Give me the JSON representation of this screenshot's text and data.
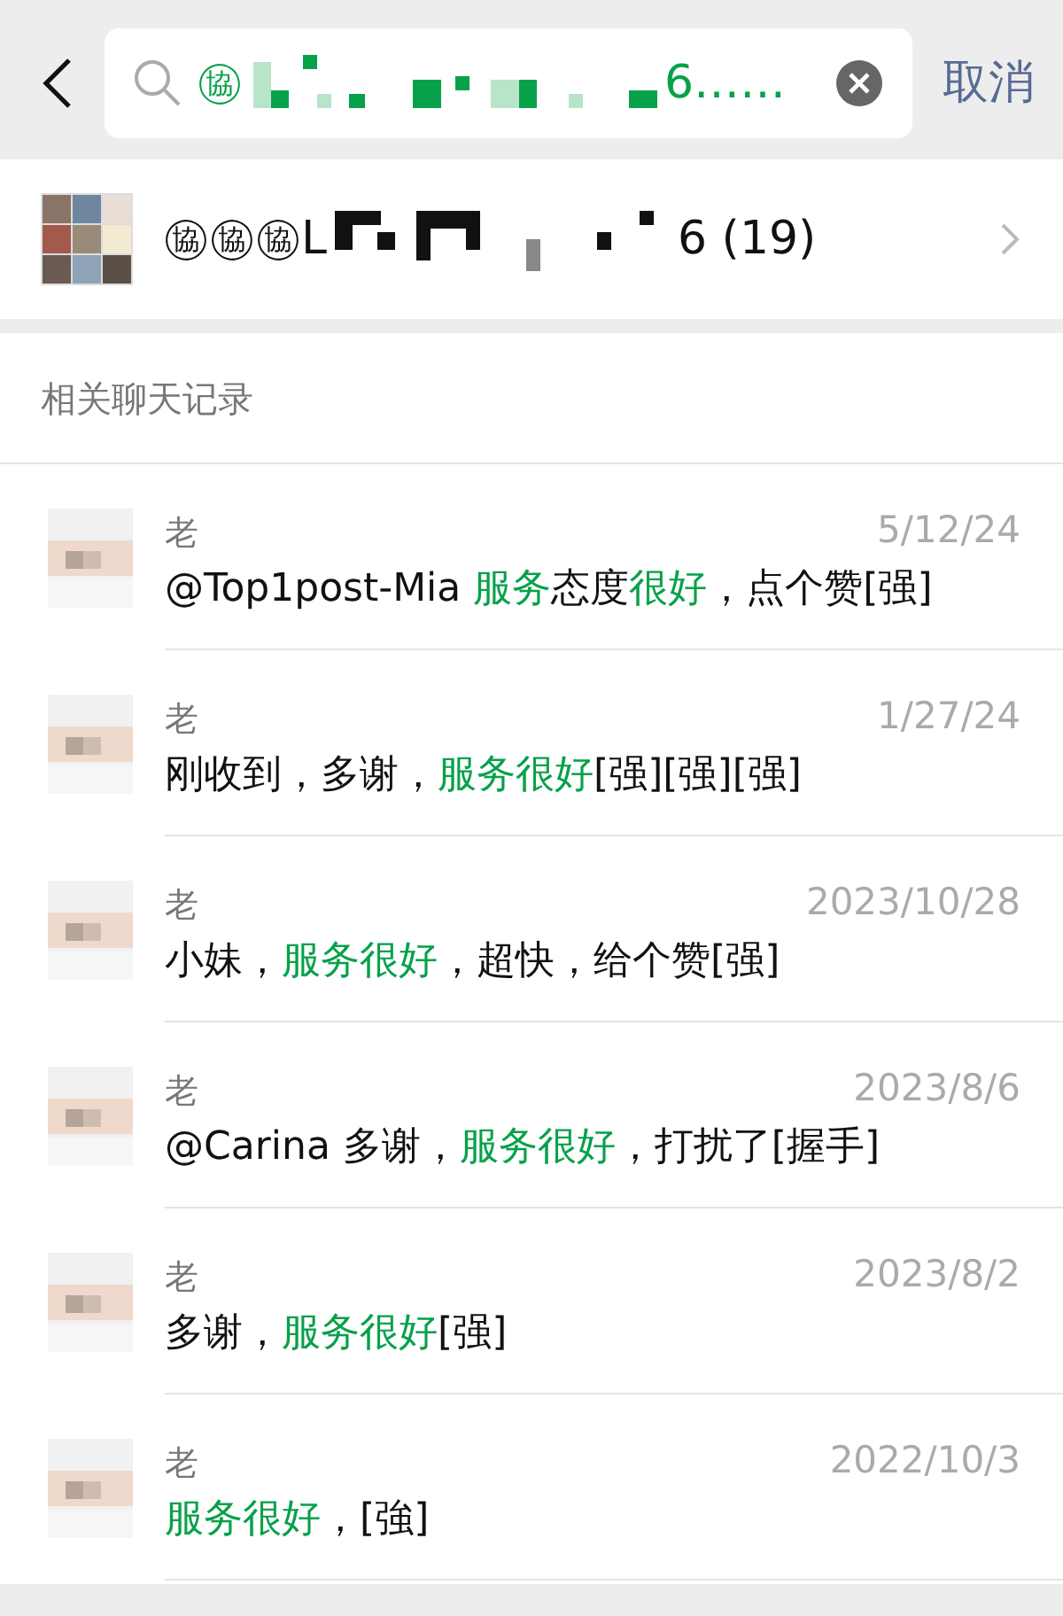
{
  "search": {
    "query_start": "㊯",
    "query_end": "6……",
    "cancel": "取消"
  },
  "group": {
    "name_start": "㊯㊯㊯L",
    "name_end": "6 (19)"
  },
  "section_title": "相关聊天记录",
  "results": [
    {
      "sender": "老",
      "date": "5/12/24",
      "segments": [
        {
          "text": "@Top1post-Mia ",
          "highlight": false
        },
        {
          "text": "服务",
          "highlight": true
        },
        {
          "text": "态度",
          "highlight": false
        },
        {
          "text": "很好",
          "highlight": true
        },
        {
          "text": "，点个赞[强]",
          "highlight": false
        }
      ]
    },
    {
      "sender": "老",
      "date": "1/27/24",
      "segments": [
        {
          "text": "刚收到，多谢，",
          "highlight": false
        },
        {
          "text": "服务很好",
          "highlight": true
        },
        {
          "text": "[强][强][强]",
          "highlight": false
        }
      ]
    },
    {
      "sender": "老",
      "date": "2023/10/28",
      "segments": [
        {
          "text": "小妹，",
          "highlight": false
        },
        {
          "text": "服务很好",
          "highlight": true
        },
        {
          "text": "，超快，给个赞[强]",
          "highlight": false
        }
      ]
    },
    {
      "sender": "老",
      "date": "2023/8/6",
      "segments": [
        {
          "text": "@Carina 多谢，",
          "highlight": false
        },
        {
          "text": "服务很好",
          "highlight": true
        },
        {
          "text": "，打扰了[握手]",
          "highlight": false
        }
      ]
    },
    {
      "sender": "老",
      "date": "2023/8/2",
      "segments": [
        {
          "text": "多谢，",
          "highlight": false
        },
        {
          "text": "服务很好",
          "highlight": true
        },
        {
          "text": "[强]",
          "highlight": false
        }
      ]
    },
    {
      "sender": "老",
      "date": "2022/10/3",
      "segments": [
        {
          "text": "服务很好",
          "highlight": true
        },
        {
          "text": "，[強]",
          "highlight": false
        }
      ]
    }
  ]
}
